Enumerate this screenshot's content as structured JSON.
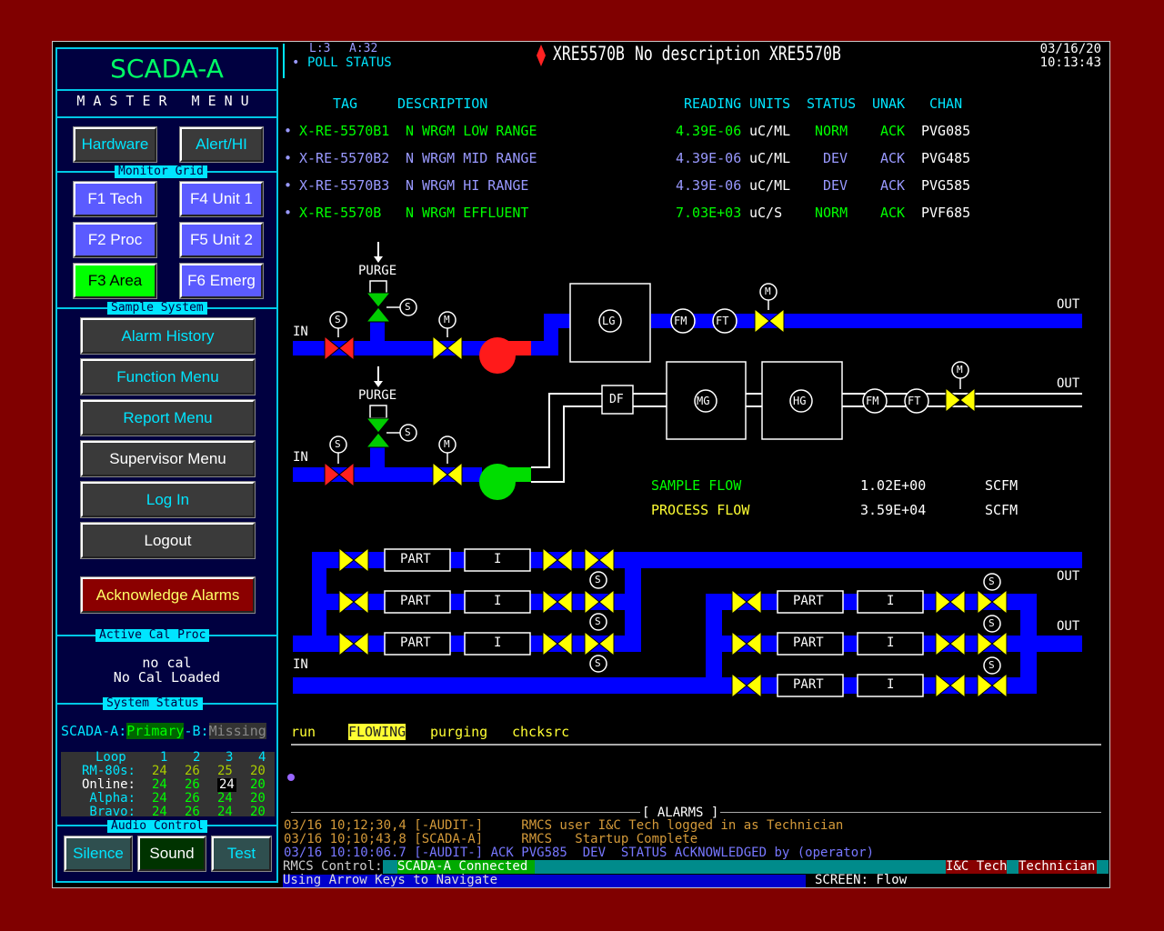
{
  "app": {
    "title": "SCADA-A",
    "master_menu": "MASTER  MENU"
  },
  "menu": {
    "hardware": "Hardware",
    "alert_hi": "Alert/HI",
    "monitor_grid_label": "Monitor Grid",
    "f1": "F1 Tech",
    "f2": "F2 Proc",
    "f3": "F3 Area",
    "f4": "F4 Unit 1",
    "f5": "F5 Unit 2",
    "f6": "F6 Emerg",
    "sample_system_label": "Sample System",
    "alarm_history": "Alarm History",
    "function_menu": "Function Menu",
    "report_menu": "Report Menu",
    "supervisor_menu": "Supervisor Menu",
    "log_in": "Log In",
    "logout": "Logout",
    "ack_alarms": "Acknowledge Alarms",
    "active_cal_label": "Active Cal Proc",
    "cal_line1": "no cal",
    "cal_line2": "No Cal Loaded",
    "system_status_label": "System  Status",
    "sys_a_label": "SCADA-A:",
    "sys_a_val": "Primary",
    "sys_b_label": "-B:",
    "sys_b_val": "Missing",
    "audio_label": "Audio Control",
    "silence": "Silence",
    "sound": "Sound",
    "test": "Test"
  },
  "grid": {
    "loop": "Loop",
    "cols": [
      "1",
      "2",
      "3",
      "4"
    ],
    "rows": [
      {
        "label": "RM-80s:",
        "vals": [
          "24",
          "26",
          "25",
          "20"
        ]
      },
      {
        "label": "Online:",
        "vals": [
          "24",
          "26",
          "24",
          "20"
        ]
      },
      {
        "label": "Alpha:",
        "vals": [
          "24",
          "26",
          "24",
          "20"
        ]
      },
      {
        "label": "Bravo:",
        "vals": [
          "24",
          "26",
          "24",
          "20"
        ]
      }
    ]
  },
  "header": {
    "l": "L:3",
    "a": "A:32",
    "poll": "POLL STATUS",
    "tag": "XRE5570B",
    "desc": "No description XRE5570B",
    "date": "03/16/20",
    "time": "10:13:43"
  },
  "table": {
    "headers": [
      "TAG",
      "DESCRIPTION",
      "READING",
      "UNITS",
      "STATUS",
      "UNAK",
      "CHAN"
    ],
    "rows": [
      {
        "tag": "X-RE-5570B1",
        "desc": "N WRGM LOW RANGE",
        "reading": "4.39E-06",
        "units": "uC/ML",
        "status": "NORM",
        "unak": "ACK",
        "chan": "PVG085"
      },
      {
        "tag": "X-RE-5570B2",
        "desc": "N WRGM MID RANGE",
        "reading": "4.39E-06",
        "units": "uC/ML",
        "status": "DEV",
        "unak": "ACK",
        "chan": "PVG485"
      },
      {
        "tag": "X-RE-5570B3",
        "desc": "N WRGM HI RANGE",
        "reading": "4.39E-06",
        "units": "uC/ML",
        "status": "DEV",
        "unak": "ACK",
        "chan": "PVG585"
      },
      {
        "tag": "X-RE-5570B",
        "desc": "N WRGM EFFLUENT",
        "reading": "7.03E+03",
        "units": "uC/S",
        "status": "NORM",
        "unak": "ACK",
        "chan": "PVF685"
      }
    ]
  },
  "diagram": {
    "purge": "PURGE",
    "in": "IN",
    "out": "OUT",
    "s": "S",
    "m": "M",
    "lg": "LG",
    "mg": "MG",
    "hg": "HG",
    "fm": "FM",
    "ft": "FT",
    "df": "DF",
    "part": "PART",
    "i": "I",
    "sample_flow_label": "SAMPLE FLOW",
    "sample_flow_val": "1.02E+00",
    "process_flow_label": "PROCESS FLOW",
    "process_flow_val": "3.59E+04",
    "flow_units": "SCFM"
  },
  "states": {
    "run": "run",
    "flowing": "FLOWING",
    "purging": "purging",
    "chcksrc": "chcksrc"
  },
  "alarms": {
    "title": "[ ALARMS ]",
    "lines": [
      "03/16 10;12;30,4 [-AUDIT-]     RMCS user I&C Tech logged in as Technician",
      "03/16 10;10;43,8 [SCADA-A]     RMCS   Startup Complete",
      "03/16 10:10:06.7 [-AUDIT-] ACK PVG585  DEV  STATUS ACKNOWLEDGED by (operator)"
    ]
  },
  "statusbar": {
    "control": "RMCS Control:",
    "connected": "SCADA-A Connected",
    "user": "I&C Tech",
    "role": "Technician",
    "hint": "Using Arrow Keys to Navigate",
    "screen": "SCREEN: Flow"
  },
  "colors": {
    "pipe": "#0000ff",
    "valve_open": "#ffff00",
    "valve_closed": "#ff0000",
    "valve_purge": "#00cc00",
    "background": "#800000"
  }
}
